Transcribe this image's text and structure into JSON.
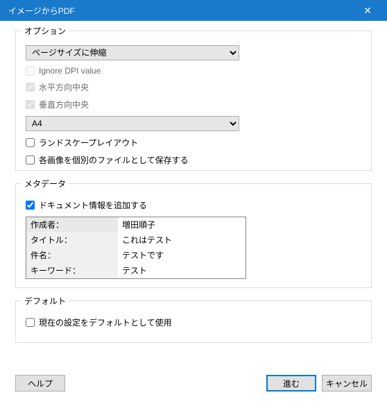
{
  "titlebar": {
    "title": "イメージからPDF"
  },
  "options": {
    "label": "オプション",
    "scale_mode": "ページサイズに伸縮",
    "ignore_dpi": "Ignore DPI value",
    "center_h": "水平方向中央",
    "center_v": "垂直方向中央",
    "page_size": "A4",
    "landscape": "ランドスケープレイアウト",
    "separate_files": "各画像を個別のファイルとして保存する"
  },
  "metadata": {
    "label": "メタデータ",
    "add_doc_info": "ドキュメント情報を追加する",
    "rows": {
      "author_label": "作成者：",
      "author_value": "増田順子",
      "title_label": "タイトル：",
      "title_value": "これはテスト",
      "subject_label": "件名：",
      "subject_value": "テストです",
      "keywords_label": "キーワード：",
      "keywords_value": "テスト"
    }
  },
  "defaults": {
    "label": "デフォルト",
    "use_default": "現在の設定をデフォルトとして使用"
  },
  "buttons": {
    "help": "ヘルプ",
    "proceed": "進む",
    "cancel": "キャンセル"
  }
}
